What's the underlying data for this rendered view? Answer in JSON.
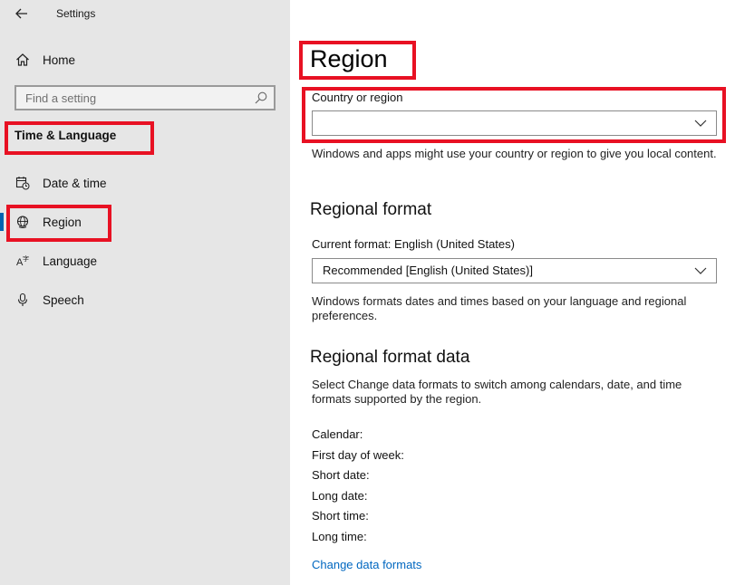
{
  "app": {
    "title": "Settings"
  },
  "sidebar": {
    "home_label": "Home",
    "search_placeholder": "Find a setting",
    "section_header": "Time & Language",
    "items": [
      {
        "label": "Date & time",
        "icon": "calendar-clock-icon"
      },
      {
        "label": "Region",
        "icon": "globe-icon",
        "selected": true
      },
      {
        "label": "Language",
        "icon": "language-icon"
      },
      {
        "label": "Speech",
        "icon": "microphone-icon"
      }
    ]
  },
  "main": {
    "title": "Region",
    "country": {
      "label": "Country or region",
      "value": "",
      "description": "Windows and apps might use your country or region to give you local content."
    },
    "regional_format": {
      "heading": "Regional format",
      "current_label": "Current format: English (United States)",
      "dropdown_value": "Recommended [English (United States)]",
      "description": "Windows formats dates and times based on your language and regional preferences."
    },
    "format_data": {
      "heading": "Regional format data",
      "description": "Select Change data formats to switch among calendars, date, and time formats supported by the region.",
      "rows": [
        "Calendar:",
        "First day of week:",
        "Short date:",
        "Long date:",
        "Short time:",
        "Long time:"
      ],
      "link": "Change data formats"
    }
  },
  "colors": {
    "highlight_box": "#e81123",
    "accent": "#0063b1",
    "link": "#0067c0"
  }
}
